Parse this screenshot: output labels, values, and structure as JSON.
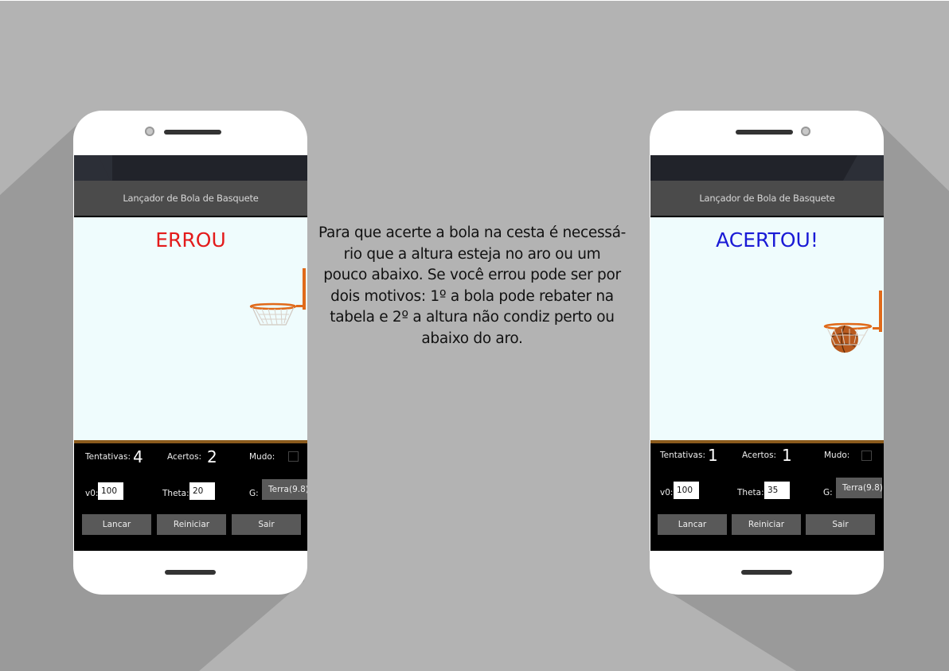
{
  "app_title": "Lançador de Bola de Basquete",
  "explanation": {
    "lines": [
      "Para que acerte a bola na cesta é necessá-",
      "rio que a altura esteja no aro ou um",
      "pouco abaixo. Se você errou pode ser por",
      "dois motivos: 1º a bola pode rebater na",
      "tabela e 2º a altura não condiz perto ou",
      "abaixo do aro."
    ]
  },
  "left_phone": {
    "result_text": "ERROU",
    "result_color": "#e31b1b",
    "tentativas_label": "Tentativas:",
    "tentativas_value": "4",
    "acertos_label": "Acertos:",
    "acertos_value": "2",
    "mudo_label": "Mudo:",
    "v0_label": "v0:",
    "v0_value": "100",
    "theta_label": "Theta:",
    "theta_value": "20",
    "g_label": "G:",
    "g_value": "Terra(9.8)",
    "lancar_label": "Lancar",
    "reiniciar_label": "Reiniciar",
    "sair_label": "Sair"
  },
  "right_phone": {
    "result_text": "ACERTOU!",
    "result_color": "#1a1ad6",
    "tentativas_label": "Tentativas:",
    "tentativas_value": "1",
    "acertos_label": "Acertos:",
    "acertos_value": "1",
    "mudo_label": "Mudo:",
    "v0_label": "v0:",
    "v0_value": "100",
    "theta_label": "Theta:",
    "theta_value": "35",
    "g_label": "G:",
    "g_value": "Terra(9.8)",
    "lancar_label": "Lancar",
    "reiniciar_label": "Reiniciar",
    "sair_label": "Sair"
  },
  "icons": [
    "camera-icon",
    "speaker-icon",
    "home-bar-icon",
    "basketball-hoop-icon",
    "basketball-icon",
    "checkbox-icon"
  ]
}
